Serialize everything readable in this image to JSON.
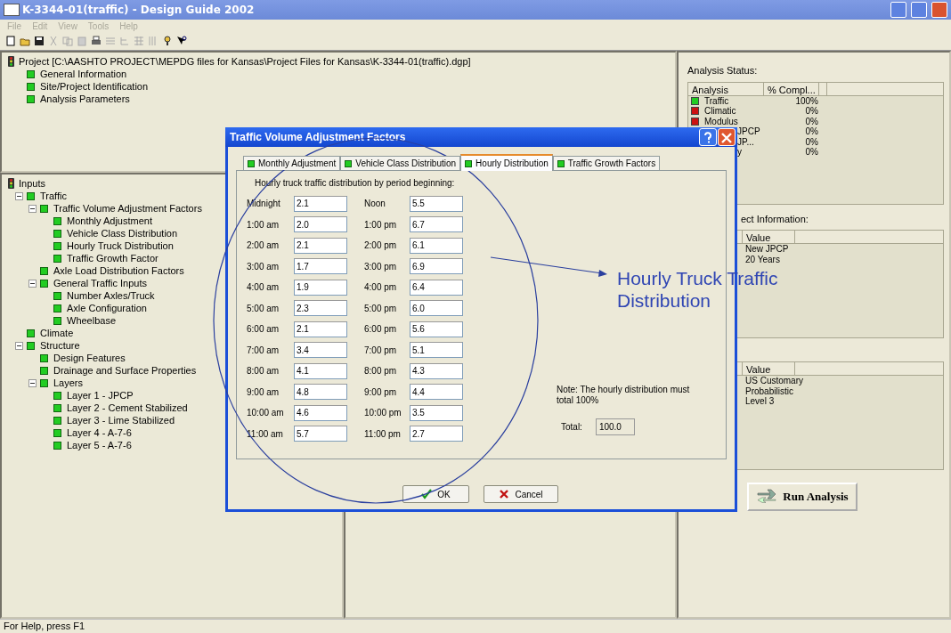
{
  "window": {
    "title": "K-3344-01(traffic) - Design Guide 2002"
  },
  "menu": [
    "File",
    "Edit",
    "View",
    "Tools",
    "Help"
  ],
  "project_tree": {
    "label": "Project [C:\\AASHTO PROJECT\\MEPDG  files for Kansas\\Project Files for Kansas\\K-3344-01(traffic).dgp]",
    "children": [
      {
        "label": "General Information"
      },
      {
        "label": "Site/Project Identification"
      },
      {
        "label": "Analysis Parameters"
      }
    ]
  },
  "inputs_tree": {
    "label": "Inputs",
    "children": [
      {
        "label": "Traffic",
        "expanded": true,
        "children": [
          {
            "label": "Traffic Volume Adjustment Factors",
            "expanded": true,
            "children": [
              {
                "label": "Monthly Adjustment"
              },
              {
                "label": "Vehicle Class Distribution"
              },
              {
                "label": "Hourly Truck Distribution"
              },
              {
                "label": "Traffic Growth Factor"
              }
            ]
          },
          {
            "label": "Axle Load Distribution Factors"
          },
          {
            "label": "General Traffic Inputs",
            "expanded": true,
            "children": [
              {
                "label": "Number Axles/Truck"
              },
              {
                "label": "Axle Configuration"
              },
              {
                "label": "Wheelbase"
              }
            ]
          }
        ]
      },
      {
        "label": "Climate"
      },
      {
        "label": "Structure",
        "expanded": true,
        "children": [
          {
            "label": "Design Features"
          },
          {
            "label": "Drainage and Surface Properties"
          },
          {
            "label": "Layers",
            "expanded": true,
            "children": [
              {
                "label": "Layer 1 - JPCP"
              },
              {
                "label": "Layer 2 - Cement Stabilized"
              },
              {
                "label": "Layer 3 - Lime Stabilized"
              },
              {
                "label": "Layer 4 - A-7-6"
              },
              {
                "label": "Layer 5 - A-7-6"
              }
            ]
          }
        ]
      }
    ]
  },
  "analysis_status": {
    "title": "Analysis Status:",
    "columns": [
      "Analysis",
      "% Compl..."
    ],
    "rows": [
      {
        "name": "Traffic",
        "value": "100%",
        "color": "#22cc22"
      },
      {
        "name": "Climatic",
        "value": "0%",
        "color": "#cc1111"
      },
      {
        "name": "Modulus",
        "value": "0%",
        "color": "#cc1111"
      },
      {
        "name": "JPCP",
        "value": "0%"
      },
      {
        "name": "JP...",
        "value": "0%"
      },
      {
        "name": "y",
        "value": "0%"
      }
    ]
  },
  "project_information": {
    "title": "ect Information:",
    "column": "Value",
    "values": [
      "New JPCP",
      "20 Years"
    ]
  },
  "settings": {
    "column": "Value",
    "values": [
      "US Customary",
      "Probabilistic",
      "Level 3"
    ]
  },
  "run_button": "Run Analysis",
  "status_bar": "For Help, press F1",
  "dialog": {
    "title": "Traffic Volume Adjustment Factors",
    "tabs": [
      {
        "label": "Monthly Adjustment",
        "selected": false
      },
      {
        "label": "Vehicle Class Distribution",
        "selected": false
      },
      {
        "label": "Hourly Distribution",
        "selected": true
      },
      {
        "label": "Traffic Growth Factors",
        "selected": false
      }
    ],
    "caption": "Hourly truck traffic distribution by period beginning:",
    "hours": [
      {
        "label": "Midnight",
        "value": "2.1"
      },
      {
        "label": "1:00 am",
        "value": "2.0"
      },
      {
        "label": "2:00 am",
        "value": "2.1"
      },
      {
        "label": "3:00 am",
        "value": "1.7"
      },
      {
        "label": "4:00 am",
        "value": "1.9"
      },
      {
        "label": "5:00 am",
        "value": "2.3"
      },
      {
        "label": "6:00 am",
        "value": "2.1"
      },
      {
        "label": "7:00 am",
        "value": "3.4"
      },
      {
        "label": "8:00 am",
        "value": "4.1"
      },
      {
        "label": "9:00 am",
        "value": "4.8"
      },
      {
        "label": "10:00 am",
        "value": "4.6"
      },
      {
        "label": "11:00 am",
        "value": "5.7"
      },
      {
        "label": "Noon",
        "value": "5.5"
      },
      {
        "label": "1:00 pm",
        "value": "6.7"
      },
      {
        "label": "2:00 pm",
        "value": "6.1"
      },
      {
        "label": "3:00 pm",
        "value": "6.9"
      },
      {
        "label": "4:00 pm",
        "value": "6.4"
      },
      {
        "label": "5:00 pm",
        "value": "6.0"
      },
      {
        "label": "6:00 pm",
        "value": "5.6"
      },
      {
        "label": "7:00 pm",
        "value": "5.1"
      },
      {
        "label": "8:00 pm",
        "value": "4.3"
      },
      {
        "label": "9:00 pm",
        "value": "4.4"
      },
      {
        "label": "10:00 pm",
        "value": "3.5"
      },
      {
        "label": "11:00 pm",
        "value": "2.7"
      }
    ],
    "note": "Note: The hourly distribution must total 100%",
    "total_label": "Total:",
    "total_value": "100.0",
    "buttons": [
      {
        "kind": "ok",
        "label": "OK"
      },
      {
        "kind": "cancel",
        "label": "Cancel"
      }
    ]
  },
  "annotation": {
    "text": "Hourly Truck Traffic Distribution"
  }
}
